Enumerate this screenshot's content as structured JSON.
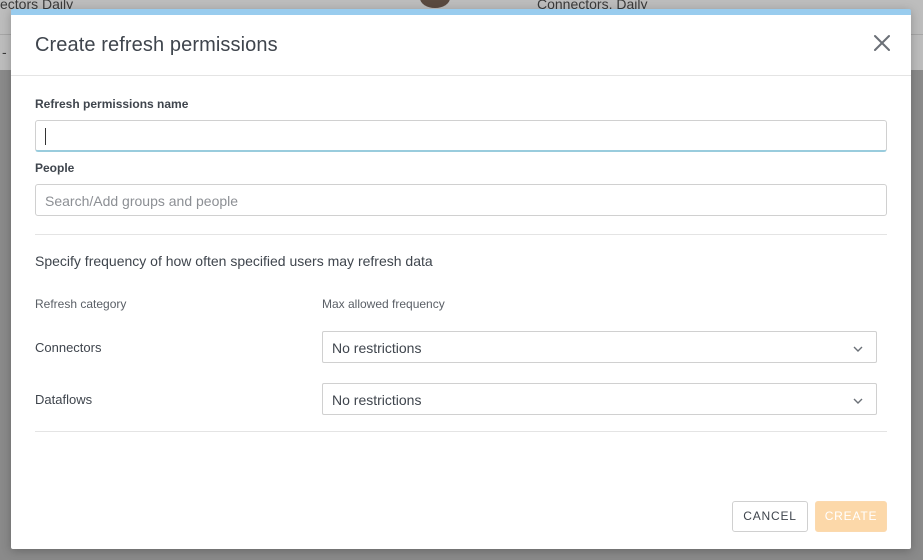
{
  "background": {
    "left_text": "ectors Daily",
    "right_text": "Connectors, Daily",
    "dash": "-"
  },
  "modal": {
    "title": "Create refresh permissions",
    "close_icon": "close-icon",
    "name_field": {
      "label": "Refresh permissions name",
      "value": ""
    },
    "people_field": {
      "label": "People",
      "placeholder": "Search/Add groups and people"
    },
    "frequency_description": "Specify frequency of how often specified users may refresh data",
    "columns": {
      "category": "Refresh category",
      "frequency": "Max allowed frequency"
    },
    "rows": [
      {
        "category": "Connectors",
        "frequency": "No restrictions"
      },
      {
        "category": "Dataflows",
        "frequency": "No restrictions"
      }
    ],
    "buttons": {
      "cancel": "CANCEL",
      "create": "CREATE"
    }
  },
  "colors": {
    "accent_top": "#99ccee",
    "create_disabled": "#fcd8a9",
    "text": "#3f454d"
  }
}
